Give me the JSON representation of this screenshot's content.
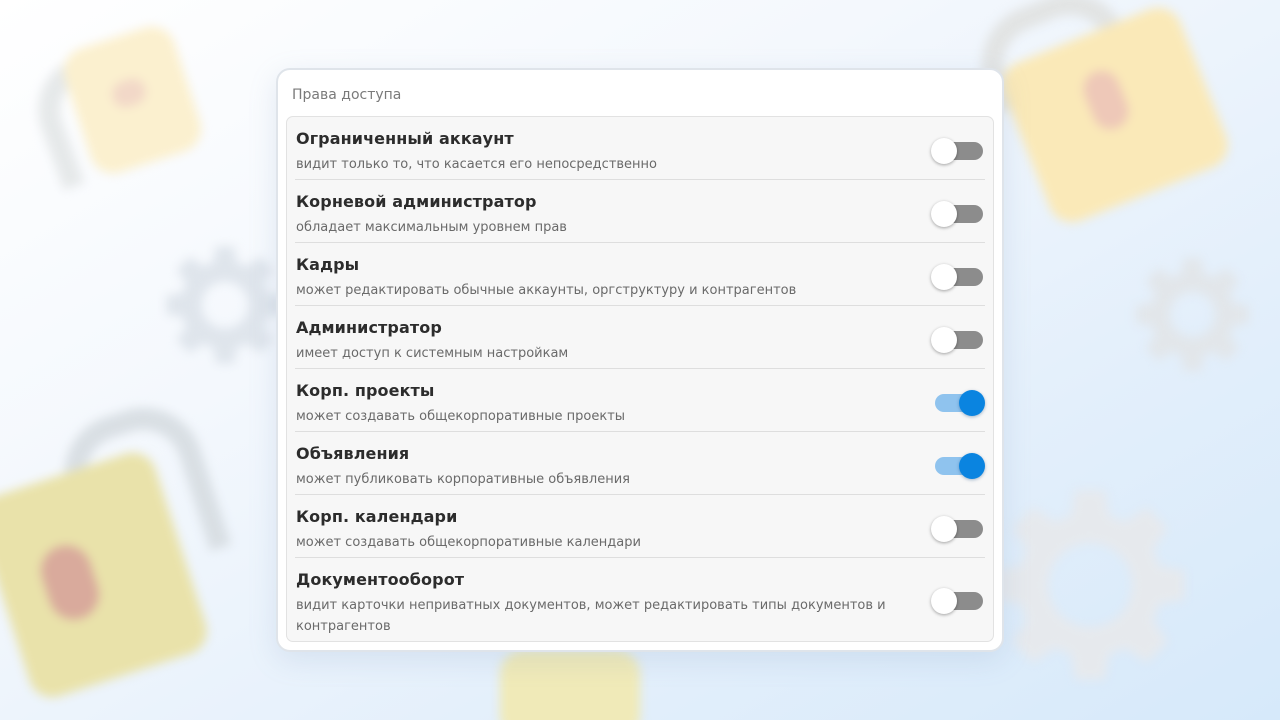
{
  "panel": {
    "title": "Права доступа"
  },
  "permissions": [
    {
      "title": "Ограниченный аккаунт",
      "description": "видит только то, что касается его непосредственно",
      "enabled": false
    },
    {
      "title": "Корневой администратор",
      "description": "обладает максимальным уровнем прав",
      "enabled": false
    },
    {
      "title": "Кадры",
      "description": "может редактировать обычные аккаунты, оргструктуру и контрагентов",
      "enabled": false
    },
    {
      "title": "Администратор",
      "description": "имеет доступ к системным настройкам",
      "enabled": false
    },
    {
      "title": "Корп. проекты",
      "description": "может создавать общекорпоративные проекты",
      "enabled": true
    },
    {
      "title": "Объявления",
      "description": "может публиковать корпоративные объявления",
      "enabled": true
    },
    {
      "title": "Корп. календари",
      "description": "может создавать общекорпоративные календари",
      "enabled": false
    },
    {
      "title": "Документооборот",
      "description": "видит карточки неприватных документов, может редактировать типы документов и контрагентов",
      "enabled": false
    }
  ],
  "colors": {
    "toggle_on": "#0a84e0",
    "toggle_on_track": "#8fc3ee",
    "toggle_off_track": "#8c8c8c"
  },
  "background": {
    "icons": [
      "lock-icon",
      "gear-icon"
    ]
  }
}
